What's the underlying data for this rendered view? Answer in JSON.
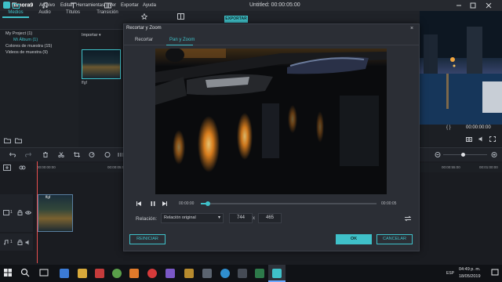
{
  "app": {
    "logo": "filmora9",
    "menu": [
      "Archivo",
      "Editar",
      "Herramientas",
      "Ver",
      "Exportar",
      "Ayuda"
    ],
    "window_title": "Untitled:",
    "window_time": "00:00:05:00"
  },
  "toolbar": {
    "tabs": [
      {
        "label": "Medios",
        "icon": "folder-icon"
      },
      {
        "label": "Audio",
        "icon": "music-note-icon"
      },
      {
        "label": "Títulos",
        "icon": "text-icon"
      },
      {
        "label": "Transición",
        "icon": "transition-icon"
      }
    ],
    "export_label": "EXPORTAR"
  },
  "library": {
    "project": "My Project (1)",
    "album": "Mi Álbum (1)",
    "sample_colors": "Colores de muestra (15)",
    "sample_videos": "Videos de muestra (9)",
    "import_label": "Importar",
    "clip_name": "ffgf"
  },
  "preview": {
    "time": "00:00:00:00"
  },
  "timeline": {
    "ruler_labels": [
      "00:00:00:00",
      "00:00:05:00",
      "00:00:55:00",
      "00:01:00:00"
    ],
    "clip_label": "ffgf",
    "track_video": "1",
    "track_audio": "1"
  },
  "modal": {
    "title": "Recortar y Zoom",
    "close": "×",
    "tabs": [
      "Recortar",
      "Pan y Zoom"
    ],
    "active_tab": "Pan y Zoom",
    "time_current": "00:00:00",
    "time_total": "00:00:05",
    "progress": 0.04,
    "ratio_label": "Relación:",
    "ratio_value": "Relación original",
    "width": "744",
    "dim_sep": "x",
    "height": "465",
    "reset_label": "REINICIAR",
    "ok_label": "OK",
    "cancel_label": "CANCELAR"
  },
  "taskbar": {
    "lang": "ESP",
    "time": "04:49 p. m.",
    "date": "18/05/2019"
  },
  "colors": {
    "accent": "#3fc1c9",
    "background": "#1b1d22",
    "dialog": "#2b2e35",
    "playhead": "#e94f4f"
  }
}
